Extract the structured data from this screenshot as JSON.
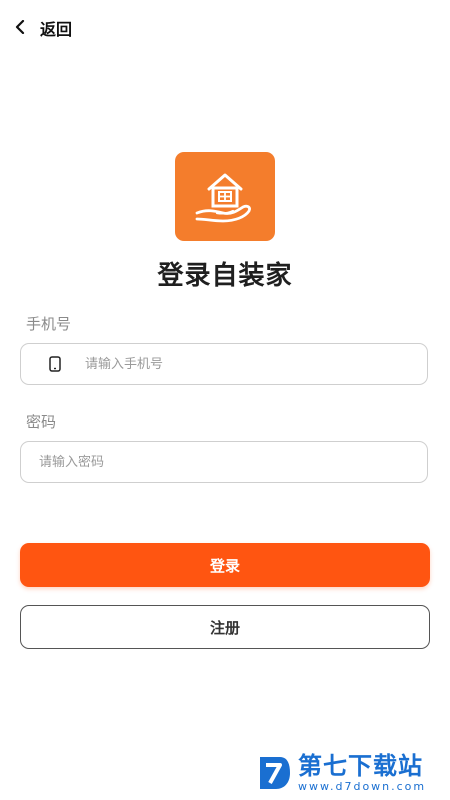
{
  "header": {
    "back_label": "返回"
  },
  "app": {
    "title": "登录自装家",
    "brand_color": "#f47d2c"
  },
  "form": {
    "phone_label": "手机号",
    "phone_placeholder": "请输入手机号",
    "password_label": "密码",
    "password_placeholder": "请输入密码"
  },
  "buttons": {
    "login_label": "登录",
    "login_color": "#ff5511",
    "register_label": "注册"
  },
  "watermark": {
    "name": "第七下载站",
    "url": "www.d7down.com",
    "color": "#1a6fd1"
  }
}
